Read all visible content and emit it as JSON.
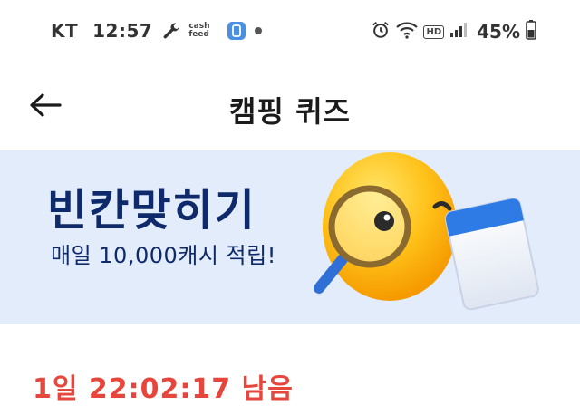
{
  "status_bar": {
    "carrier": "KT",
    "time": "12:57",
    "cashfeed_text": "cash feed",
    "hd_badge": "HD",
    "battery": "45%"
  },
  "app_bar": {
    "title": "캠핑 퀴즈"
  },
  "banner": {
    "title": "빈칸맞히기",
    "subtitle": "매일 10,000캐시 적립!"
  },
  "countdown": {
    "text": "1일 22:02:17 남음"
  },
  "colors": {
    "banner_bg": "#e3ecfb",
    "banner_text": "#0f2a6b",
    "countdown": "#e6463b"
  }
}
